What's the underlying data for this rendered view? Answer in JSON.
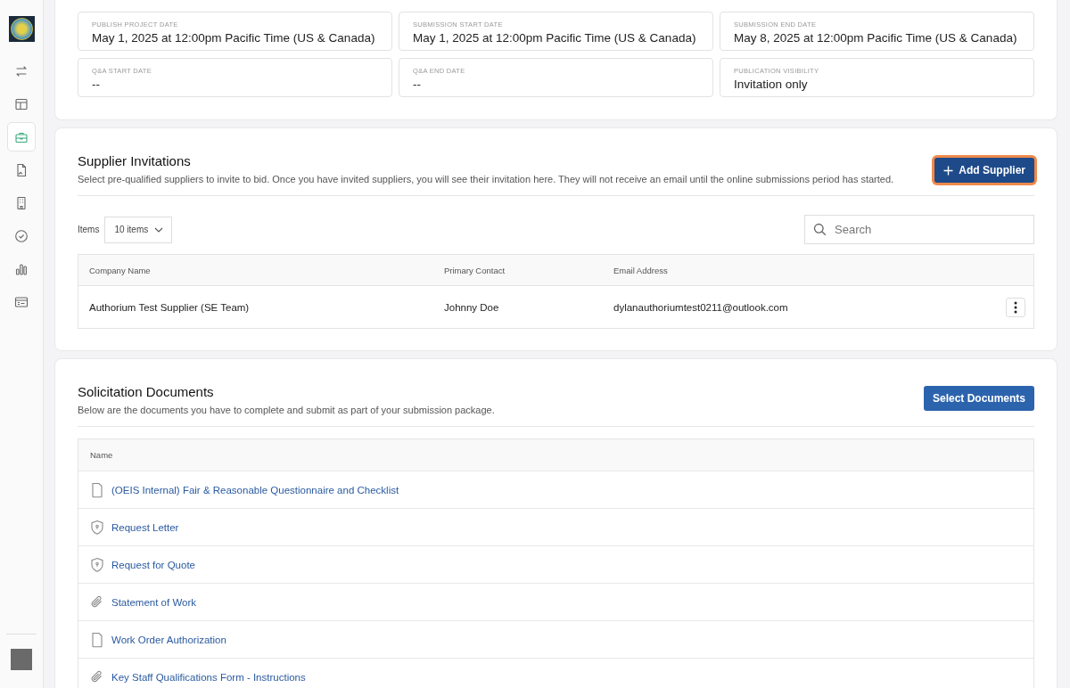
{
  "sidebar": {
    "items": [
      {
        "kind": "swap",
        "selected": false
      },
      {
        "kind": "layout",
        "selected": false
      },
      {
        "kind": "briefcase",
        "selected": true
      },
      {
        "kind": "file-image",
        "selected": false
      },
      {
        "kind": "building",
        "selected": false
      },
      {
        "kind": "check-circle",
        "selected": false
      },
      {
        "kind": "bar-chart",
        "selected": false
      },
      {
        "kind": "card-list",
        "selected": false
      }
    ]
  },
  "dates": [
    {
      "label": "PUBLISH PROJECT DATE",
      "value": "May 1, 2025 at 12:00pm Pacific Time (US & Canada)"
    },
    {
      "label": "SUBMISSION START DATE",
      "value": "May 1, 2025 at 12:00pm Pacific Time (US & Canada)"
    },
    {
      "label": "SUBMISSION END DATE",
      "value": "May 8, 2025 at 12:00pm Pacific Time (US & Canada)"
    },
    {
      "label": "Q&A START DATE",
      "value": "--"
    },
    {
      "label": "Q&A END DATE",
      "value": "--"
    },
    {
      "label": "PUBLICATION VISIBILITY",
      "value": "Invitation only"
    }
  ],
  "supplier_invitations": {
    "title": "Supplier Invitations",
    "description": "Select pre-qualified suppliers to invite to bid. Once you have invited suppliers, you will see their invitation here. They will not receive an email until the online submissions period has started.",
    "button": {
      "label": "Add Supplier",
      "focused": true
    },
    "items_label": "Items",
    "items_select": "10 items",
    "search": {
      "placeholder": "Search"
    },
    "table": {
      "columns": [
        "Company Name",
        "Primary Contact",
        "Email Address"
      ],
      "rows": [
        {
          "cells": [
            "Authorium Test Supplier (SE Team)",
            "Johnny Doe",
            "dylanauthoriumtest0211@outlook.com"
          ]
        }
      ]
    }
  },
  "solicitation_documents": {
    "title": "Solicitation Documents",
    "description": "Below are the documents you have to complete and submit as part of your submission package.",
    "button": "Select Documents",
    "column": "Name",
    "rows": [
      {
        "kind": "file",
        "name": "(OEIS Internal) Fair & Reasonable Questionnaire and Checklist"
      },
      {
        "kind": "shield",
        "name": "Request Letter"
      },
      {
        "kind": "shield",
        "name": "Request for Quote"
      },
      {
        "kind": "paperclip",
        "name": "Statement of Work"
      },
      {
        "kind": "file",
        "name": "Work Order Authorization"
      },
      {
        "kind": "paperclip",
        "name": "Key Staff Qualifications Form - Instructions"
      }
    ]
  }
}
